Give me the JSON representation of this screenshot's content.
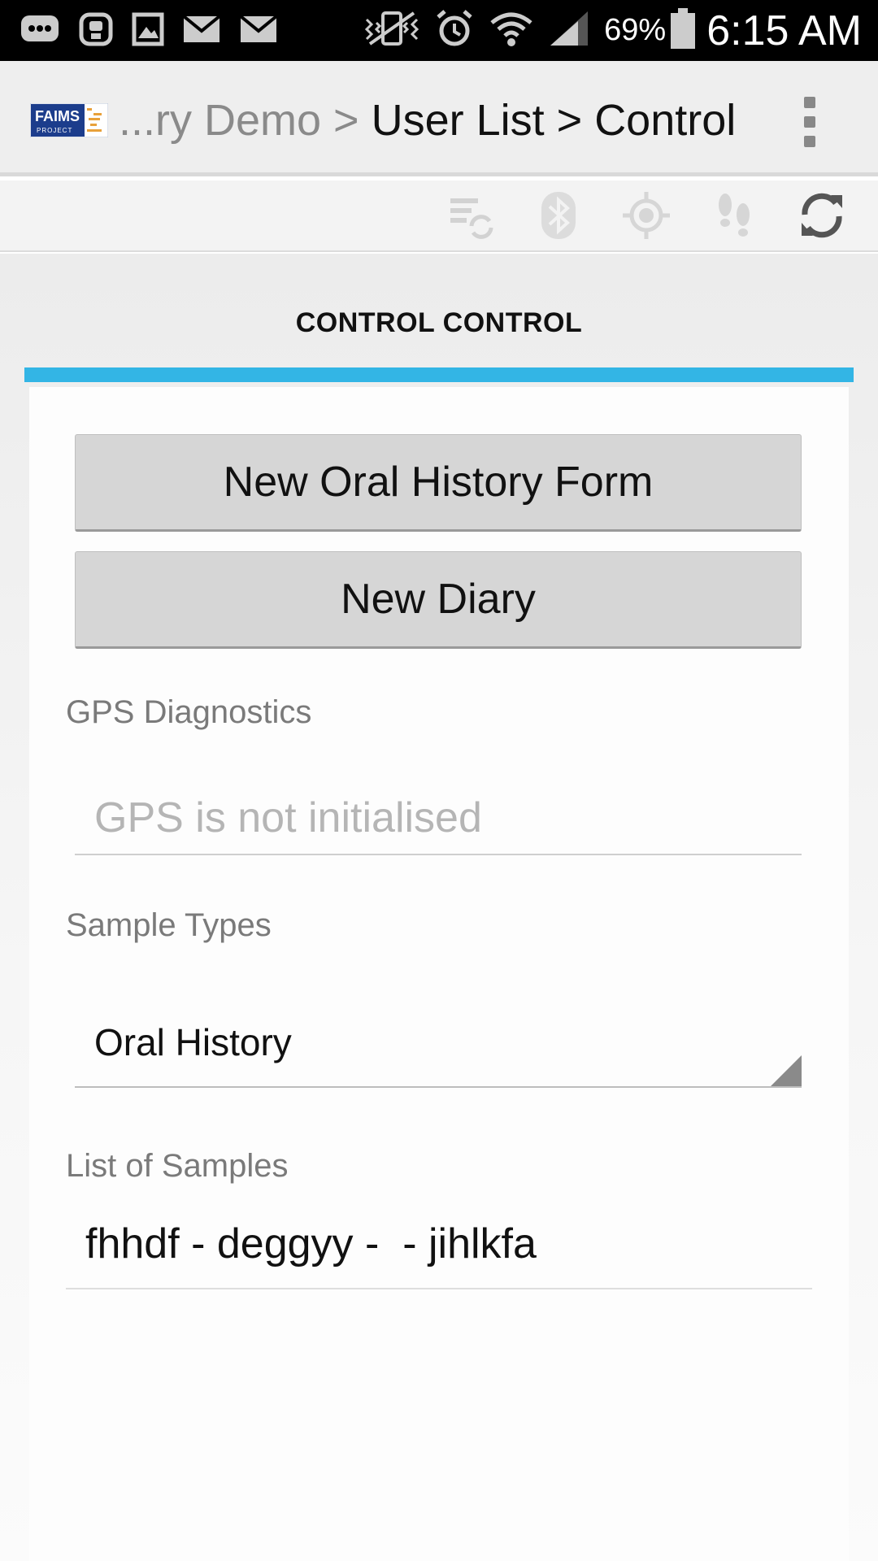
{
  "status_bar": {
    "left_icons": [
      "chat-notification-icon",
      "voicemail-icon",
      "gallery-icon",
      "email-icon",
      "email-icon"
    ],
    "right_icons": [
      "vibrate-icon",
      "alarm-icon",
      "wifi-icon",
      "signal-icon"
    ],
    "battery": "69%",
    "time": "6:15 AM"
  },
  "action_bar": {
    "logo_text": "FAIMS",
    "logo_subtext": "PROJECT",
    "crumb_1": "...ry Demo",
    "separator_1": " > ",
    "crumb_2": "User List",
    "separator_2": " > ",
    "crumb_3": "Control",
    "overflow_icon": "overflow-menu-icon"
  },
  "toolbar": {
    "icons": [
      "sync-status-icon",
      "bluetooth-icon",
      "gps-icon",
      "tracking-footsteps-icon",
      "refresh-icon"
    ]
  },
  "tab": {
    "title": "CONTROL CONTROL"
  },
  "form": {
    "new_oral_history_button": "New Oral History Form",
    "new_diary_button": "New Diary",
    "gps_label": "GPS Diagnostics",
    "gps_placeholder": "GPS is not initialised",
    "sample_types_label": "Sample Types",
    "sample_types_value": "Oral History",
    "list_label": "List of Samples",
    "list_items": [
      "fhhdf - deggyy -  - jihlkfa"
    ]
  },
  "colors": {
    "accent": "#33b5e5",
    "status_bar": "#000000",
    "action_bar": "#eeeeee",
    "button": "#d6d6d6"
  }
}
